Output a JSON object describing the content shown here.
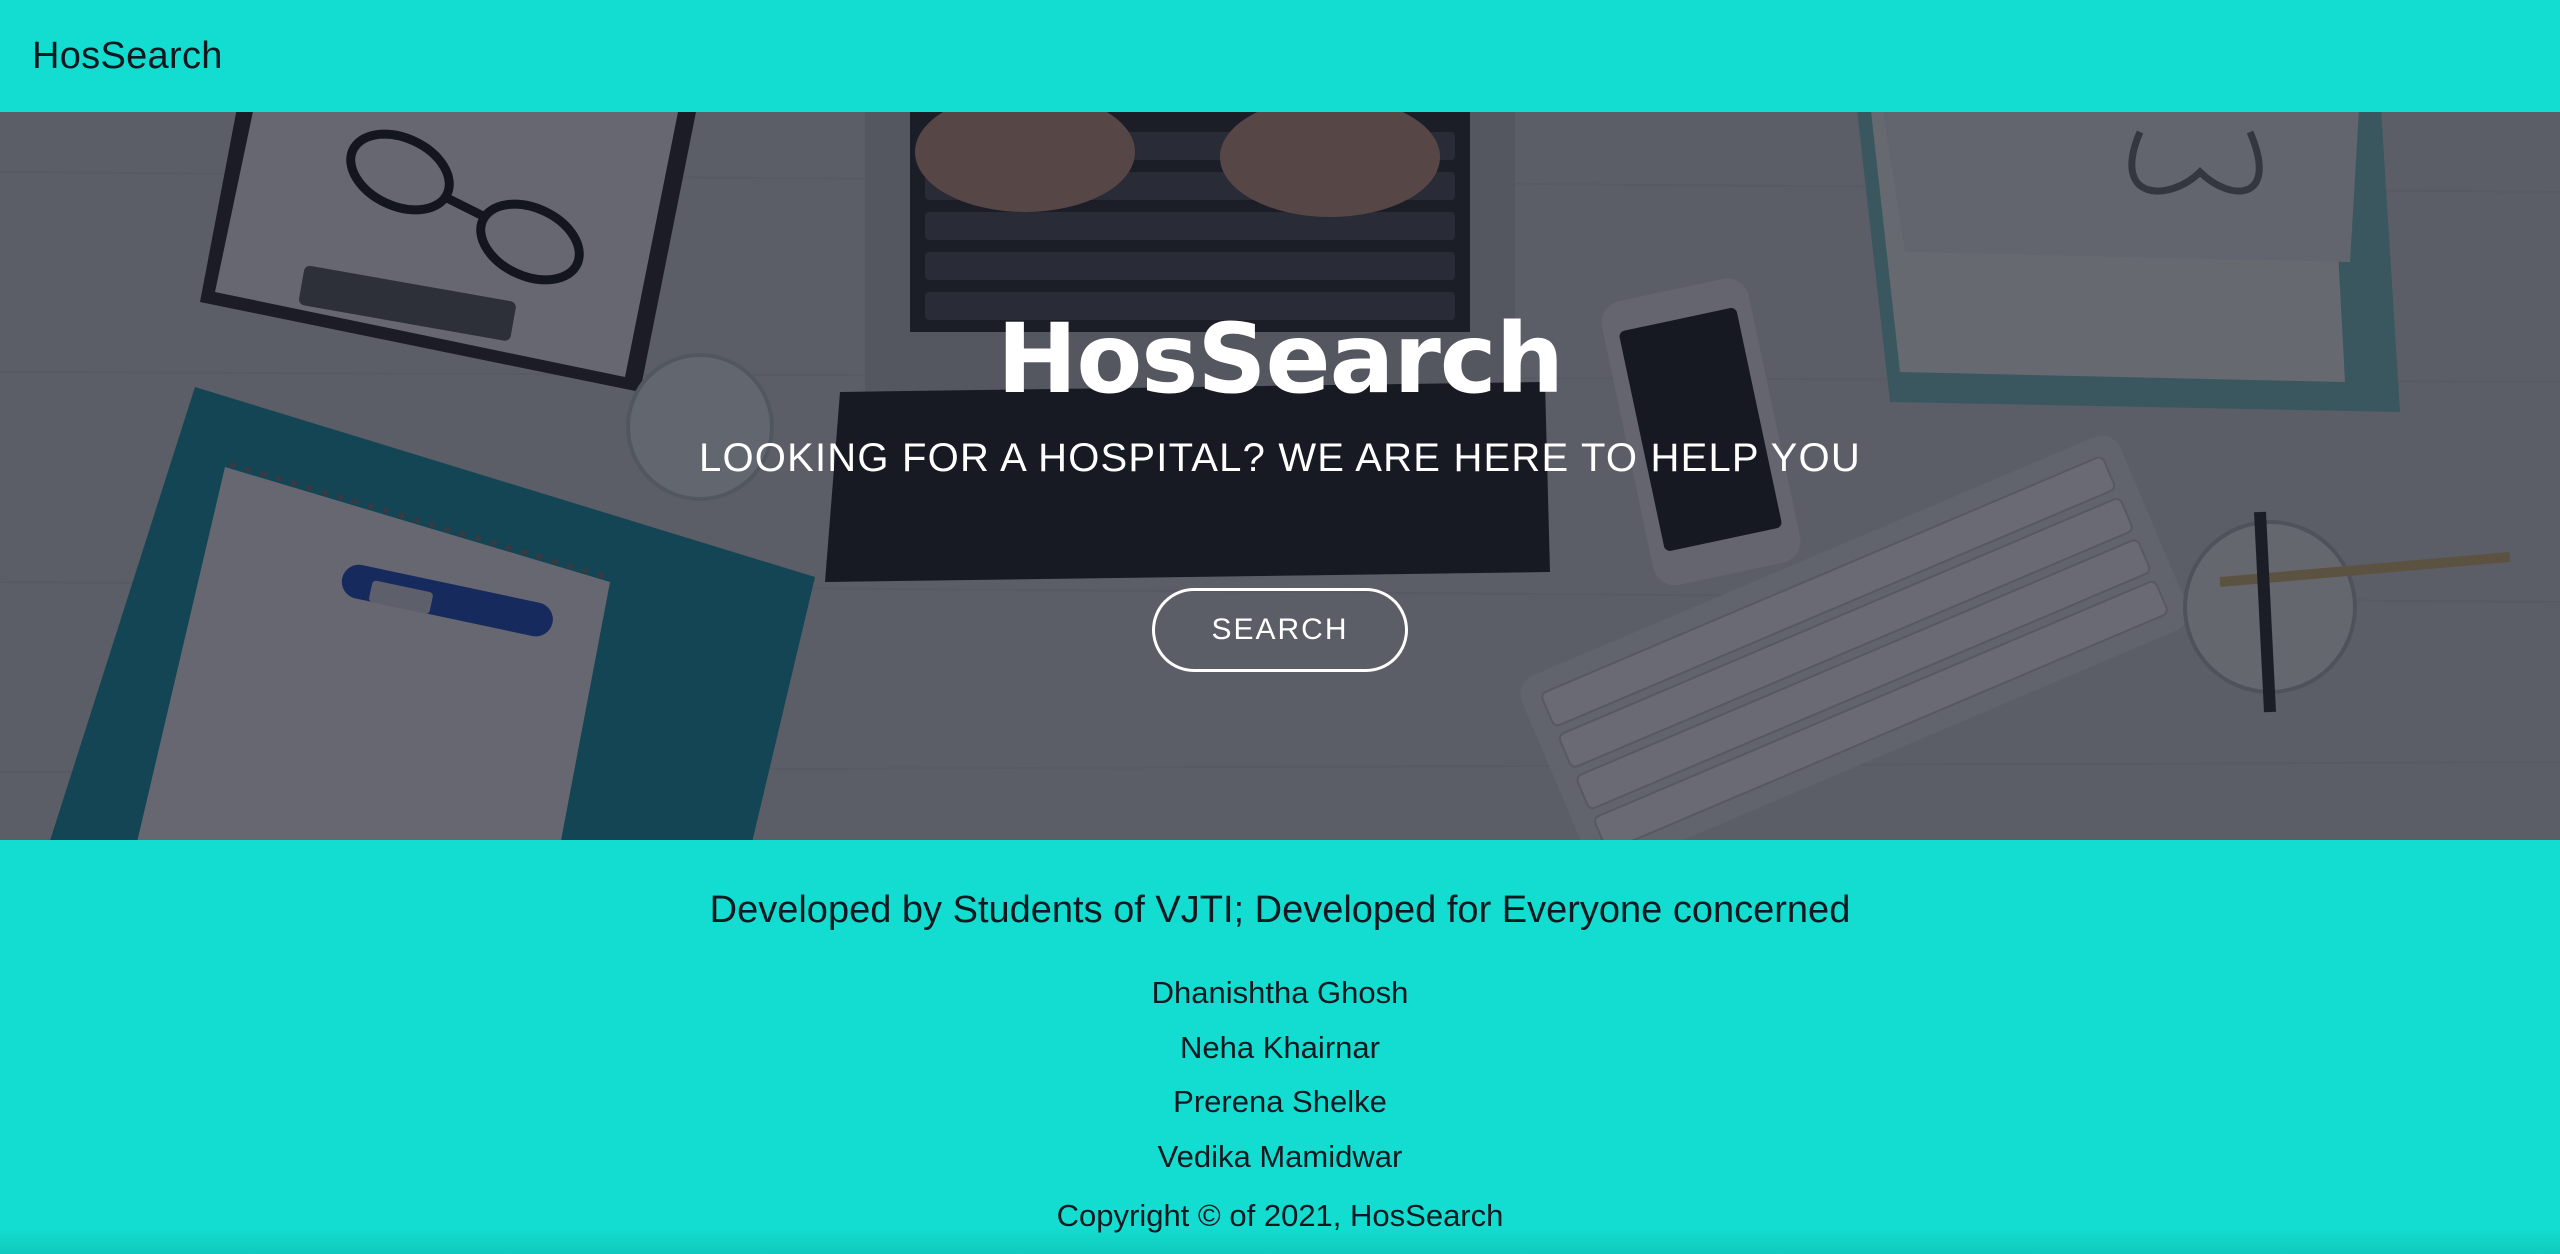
{
  "navbar": {
    "brand": "HosSearch",
    "background_color": "#12ddd0"
  },
  "hero": {
    "title": "HosSearch",
    "subtitle": "LOOKING FOR A HOSPITAL? WE ARE HERE TO HELP YOU",
    "search_button_label": "SEARCH",
    "background_image": "desk-with-laptop-clipboard-phone-keyboard"
  },
  "footer": {
    "heading": "Developed by Students of VJTI; Developed for Everyone concerned",
    "names": [
      "Dhanishtha Ghosh",
      "Neha Khairnar",
      "Prerena Shelke",
      "Vedika Mamidwar"
    ],
    "copyright": "Copyright © of 2021, HosSearch",
    "background_color": "#12ddd0"
  }
}
